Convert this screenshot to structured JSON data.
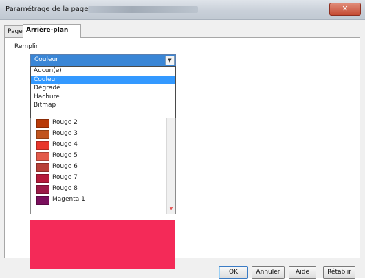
{
  "window": {
    "title": "Paramétrage de la page",
    "close_glyph": "✕"
  },
  "tabs": [
    {
      "label": "Page"
    },
    {
      "label": "Arrière-plan"
    }
  ],
  "fill": {
    "group_label": "Remplir",
    "combo_value": "Couleur",
    "options": [
      "Aucun(e)",
      "Couleur",
      "Dégradé",
      "Hachure",
      "Bitmap"
    ],
    "selected_option": "Couleur"
  },
  "colors": [
    {
      "name": "Rouge 2",
      "hex": "#b83a08"
    },
    {
      "name": "Rouge 3",
      "hex": "#c1531d"
    },
    {
      "name": "Rouge 4",
      "hex": "#e8362b"
    },
    {
      "name": "Rouge 5",
      "hex": "#e35a4a"
    },
    {
      "name": "Rouge 6",
      "hex": "#b84038"
    },
    {
      "name": "Rouge 7",
      "hex": "#b51a3a"
    },
    {
      "name": "Rouge 8",
      "hex": "#9b1a47"
    },
    {
      "name": "Magenta 1",
      "hex": "#7a0f5c"
    }
  ],
  "preview_color": "#f42a58",
  "buttons": {
    "ok": "OK",
    "cancel": "Annuler",
    "help": "Aide",
    "reset": "Rétablir"
  }
}
